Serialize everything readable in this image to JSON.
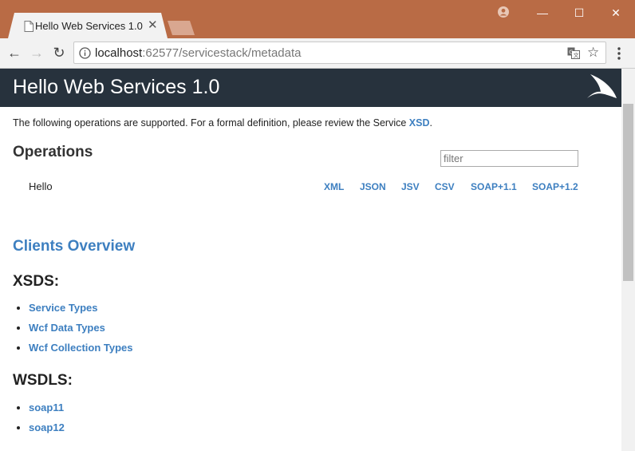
{
  "browser": {
    "tab_title": "Hello Web Services 1.0",
    "url_host": "localhost",
    "url_rest": ":62577/servicestack/metadata",
    "window_buttons": {
      "minimize": "—",
      "maximize": "☐",
      "close": "✕"
    }
  },
  "page": {
    "header_title": "Hello Web Services 1.0",
    "intro_text": "The following operations are supported. For a formal definition, please review the Service ",
    "intro_link": "XSD",
    "intro_end": ".",
    "operations_heading": "Operations",
    "filter_placeholder": "filter",
    "operations": [
      {
        "name": "Hello",
        "formats": [
          "XML",
          "JSON",
          "JSV",
          "CSV",
          "SOAP+1.1",
          "SOAP+1.2"
        ]
      }
    ],
    "clients_heading": "Clients Overview",
    "xsds_heading": "XSDS:",
    "xsds_links": [
      "Service Types",
      "Wcf Data Types",
      "Wcf Collection Types"
    ],
    "wsdls_heading": "WSDLS:",
    "wsdls_links": [
      "soap11",
      "soap12"
    ]
  },
  "colors": {
    "titlebar": "#b96b45",
    "header": "#27323d",
    "link": "#3d7fc0"
  }
}
